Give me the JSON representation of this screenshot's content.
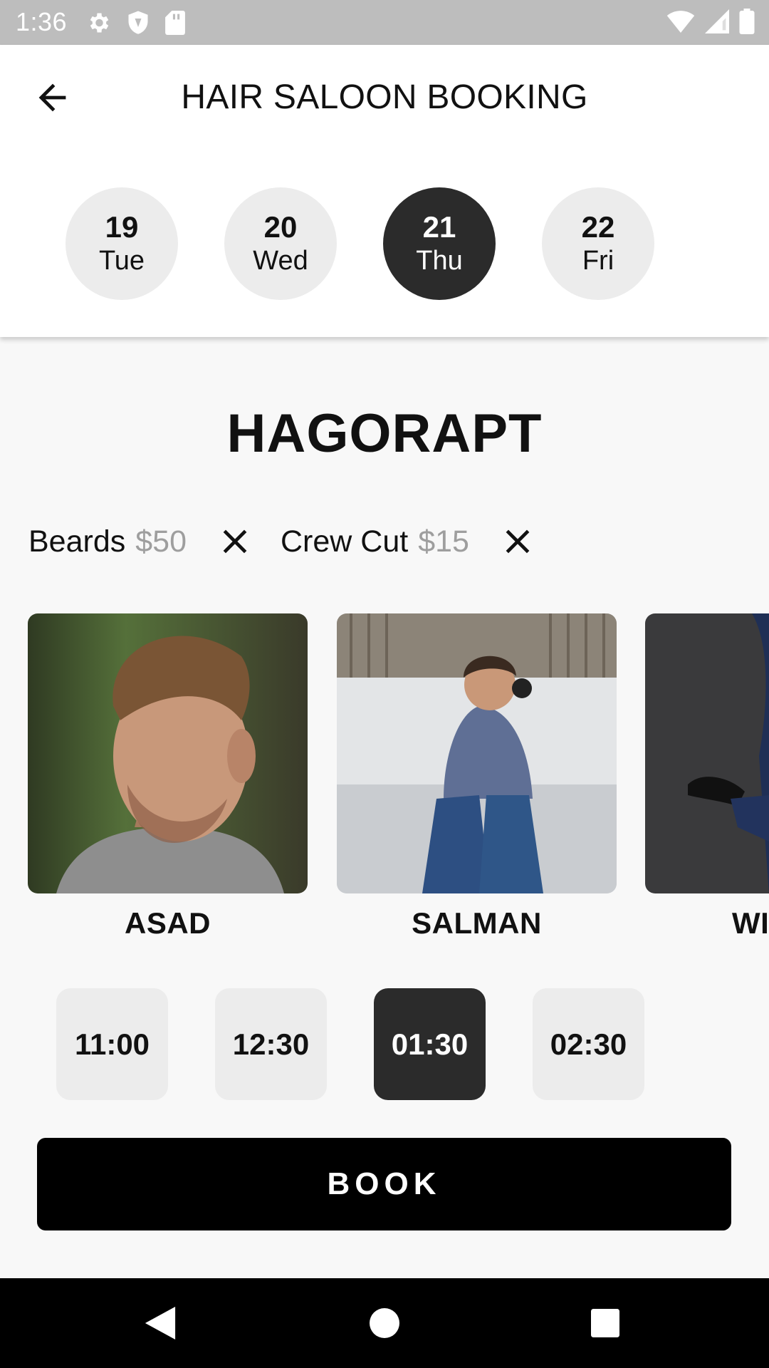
{
  "status_bar": {
    "time": "1:36",
    "icons_left": [
      "gear-icon",
      "shield-icon",
      "sd-card-icon"
    ],
    "icons_right": [
      "wifi-icon",
      "signal-icon",
      "battery-icon"
    ]
  },
  "header": {
    "title": "HAIR SALOON BOOKING",
    "back_icon": "arrow-left-icon"
  },
  "dates": [
    {
      "num": "19",
      "day": "Tue",
      "selected": false
    },
    {
      "num": "20",
      "day": "Wed",
      "selected": false
    },
    {
      "num": "21",
      "day": "Thu",
      "selected": true
    },
    {
      "num": "22",
      "day": "Fri",
      "selected": false
    }
  ],
  "salon": {
    "name": "HAGORAPT"
  },
  "services": [
    {
      "name": "Beards",
      "price": "$50"
    },
    {
      "name": "Crew Cut",
      "price": "$15"
    }
  ],
  "stylists": [
    {
      "name": "ASAD"
    },
    {
      "name": "SALMAN"
    },
    {
      "name": "WI"
    }
  ],
  "time_slots": [
    {
      "time": "11:00",
      "selected": false
    },
    {
      "time": "12:30",
      "selected": false
    },
    {
      "time": "01:30",
      "selected": true
    },
    {
      "time": "02:30",
      "selected": false
    }
  ],
  "book_button": {
    "label": "BOOK"
  },
  "nav_bar": {
    "icons": [
      "back-triangle-icon",
      "home-circle-icon",
      "recents-square-icon"
    ]
  },
  "colors": {
    "selected_bg": "#2b2b2b",
    "unselected_bg": "#ececec",
    "price_gray": "#9e9e9e",
    "book_bg": "#000000",
    "status_bar_bg": "#bdbdbd"
  }
}
